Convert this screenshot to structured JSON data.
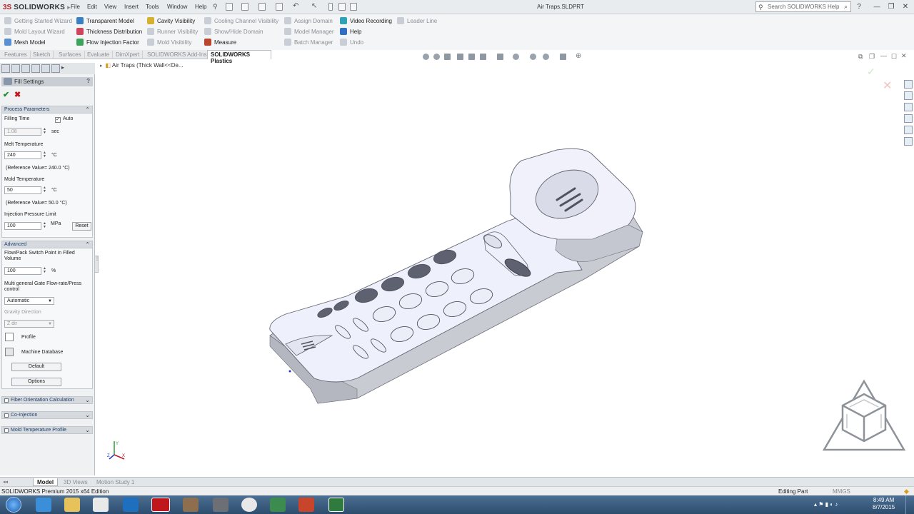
{
  "app": {
    "logo_ds": "3S",
    "logo_name": "SOLIDWORKS",
    "document_title": "Air Traps.SLDPRT"
  },
  "menu": [
    "File",
    "Edit",
    "View",
    "Insert",
    "Tools",
    "Window",
    "Help"
  ],
  "search": {
    "placeholder": "Search SOLIDWORKS Help"
  },
  "commands": {
    "col1": [
      "Getting Started Wizard",
      "Mold Layout Wizard",
      "Mesh Model"
    ],
    "col2": [
      "Transparent Model",
      "Thickness Distribution",
      "Flow Injection Factor"
    ],
    "col3": [
      "Cavity Visibility",
      "Runner Visibility",
      "Mold Visibility"
    ],
    "col4": [
      "Cooling Channel Visibility",
      "Show/Hide Domain",
      "Measure"
    ],
    "col5": [
      "Assign Domain",
      "Model Manager",
      "Batch Manager"
    ],
    "col6": [
      "Video Recording",
      "Help",
      "Undo"
    ],
    "col7": [
      "Leader Line"
    ]
  },
  "tabs": [
    "Features",
    "Sketch",
    "Surfaces",
    "Evaluate",
    "DimXpert",
    "SOLIDWORKS Add-Ins",
    "SOLIDWORKS Plastics"
  ],
  "active_tab": "SOLIDWORKS Plastics",
  "breadcrumb": "Air Traps  (Thick Wall<<De...",
  "property_manager": {
    "title": "Fill Settings",
    "help": "?",
    "process": {
      "header": "Process Parameters",
      "filling_time_label": "Filling Time",
      "auto_label": "Auto",
      "filling_time_value": "1.08",
      "filling_time_unit": "sec",
      "melt_label": "Melt Temperature",
      "melt_value": "240",
      "melt_unit": "°C",
      "melt_ref": "(Reference Value= 240.0 °C)",
      "mold_label": "Mold Temperature",
      "mold_value": "50",
      "mold_unit": "°C",
      "mold_ref": "(Reference Value= 50.0 °C)",
      "pressure_label": "Injection Pressure Limit",
      "pressure_value": "100",
      "pressure_unit": "MPa",
      "reset_label": "Reset"
    },
    "advanced": {
      "header": "Advanced",
      "switch_label": "Flow/Pack Switch Point in Filled Volume",
      "switch_value": "100",
      "switch_unit": "%",
      "gate_label": "Multi general Gate Flow-rate/Press control",
      "gate_value": "Automatic",
      "gravity_label": "Gravity Direction",
      "gravity_value": "Z dir",
      "profile_label": "Profile",
      "machine_label": "Machine Database",
      "default_label": "Default",
      "options_label": "Options"
    },
    "collapsed_groups": [
      "Fiber Orientation Calculation",
      "Co-Injection",
      "Mold Temperature Profile"
    ]
  },
  "triad": {
    "x": "X",
    "y": "Y",
    "z": "Z"
  },
  "model_tabs": [
    "Model",
    "3D Views",
    "Motion Study 1"
  ],
  "status": {
    "edition": "SOLIDWORKS Premium 2015 x64 Edition",
    "mode": "Editing Part",
    "units": "MMGS"
  },
  "clock": {
    "time": "8:49 AM",
    "date": "8/7/2015"
  },
  "colors": {
    "accent": "#b31f24",
    "model_face": "#eef0fb",
    "model_side": "#c7c9cf"
  }
}
